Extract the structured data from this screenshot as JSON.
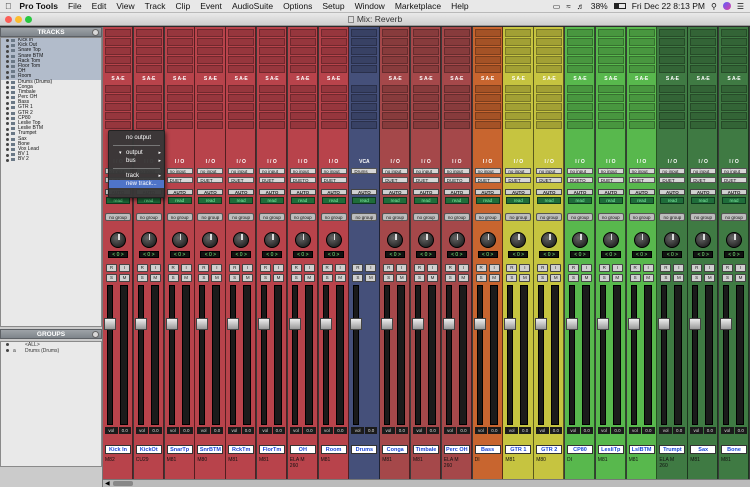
{
  "menubar": {
    "apple": "",
    "items": [
      "Pro Tools",
      "File",
      "Edit",
      "View",
      "Track",
      "Clip",
      "Event",
      "AudioSuite",
      "Options",
      "Setup",
      "Window",
      "Marketplace",
      "Help"
    ],
    "battery": "38%",
    "clock": "Fri Dec 22  8:13 PM"
  },
  "window": {
    "title": "Mix: Reverb"
  },
  "tracks_panel": {
    "title": "TRACKS",
    "items": [
      "Kick In",
      "Kick Out",
      "Snare Top",
      "Snare BTM",
      "Rack Tom",
      "Floor Tom",
      "OH",
      "Room",
      "Drums (Drums)",
      "Conga",
      "Timbale",
      "Perc OH",
      "Bass",
      "GTR 1",
      "GTR 2",
      "CP80",
      "Leslie Top",
      "Leslie BTM",
      "Trumpet",
      "Sax",
      "Bone",
      "Vox Lead",
      "BV 1",
      "BV 2"
    ]
  },
  "groups_panel": {
    "title": "GROUPS",
    "items": [
      "<ALL>",
      "Drums (Drums)"
    ]
  },
  "popup_menu": {
    "items": [
      "no output",
      "output",
      "bus",
      "track",
      "new track..."
    ]
  },
  "strip_labels": {
    "sae": "S A-E",
    "io": "I / O",
    "vca": "VCA",
    "no_input": "no input",
    "drums_in": "Drums",
    "auto": "AUTO",
    "read": "read",
    "no_group": "no group",
    "vol": "vol",
    "vol_val": "0.0",
    "pan_val": "< 0 >"
  },
  "channels": [
    {
      "name": "Kick In",
      "out": "DUET",
      "comment": "M82",
      "color": "#b8434b"
    },
    {
      "name": "KickOt",
      "out": "DUET",
      "comment": "CU29",
      "color": "#b8434b"
    },
    {
      "name": "SnarTp",
      "out": "DUET",
      "comment": "M81",
      "color": "#b8434b"
    },
    {
      "name": "SnrBTM",
      "out": "DUET",
      "comment": "M80",
      "color": "#b8434b"
    },
    {
      "name": "RckTm",
      "out": "DUET",
      "comment": "M81",
      "color": "#b8434b"
    },
    {
      "name": "FlorTm",
      "out": "DUET",
      "comment": "M81",
      "color": "#b8434b"
    },
    {
      "name": "OH",
      "out": "DUETO",
      "comment": "ELA M\n260",
      "color": "#b8434b"
    },
    {
      "name": "Room",
      "out": "DUET",
      "comment": "M81",
      "color": "#b8434b"
    },
    {
      "name": "Drums",
      "out": "",
      "comment": "",
      "color": "#45507a"
    },
    {
      "name": "Conga",
      "out": "DUET",
      "comment": "M81",
      "color": "#a5484a"
    },
    {
      "name": "Timbale",
      "out": "DUET",
      "comment": "M81",
      "color": "#a5484a"
    },
    {
      "name": "Perc OH",
      "out": "DUETO",
      "comment": "ELA M\n260",
      "color": "#a5484a"
    },
    {
      "name": "Bass",
      "out": "DUET",
      "comment": "DI",
      "color": "#c8652f"
    },
    {
      "name": "GTR 1",
      "out": "DUET",
      "comment": "M81",
      "color": "#c6c440"
    },
    {
      "name": "GTR 2",
      "out": "DUET",
      "comment": "M80",
      "color": "#c6c440"
    },
    {
      "name": "CP80",
      "out": "DUETO",
      "comment": "DI",
      "color": "#58b84d"
    },
    {
      "name": "LesliTp",
      "out": "DUET",
      "comment": "M81",
      "color": "#58b84d"
    },
    {
      "name": "LslBTM",
      "out": "DUET",
      "comment": "M81",
      "color": "#58b84d"
    },
    {
      "name": "Trumpt",
      "out": "DUET",
      "comment": "ELA M\n260",
      "color": "#3f7a43"
    },
    {
      "name": "Sax",
      "out": "DUET",
      "comment": "M81",
      "color": "#3f7a43"
    },
    {
      "name": "Bone",
      "out": "DUET",
      "comment": "M81",
      "color": "#3f7a43"
    }
  ]
}
